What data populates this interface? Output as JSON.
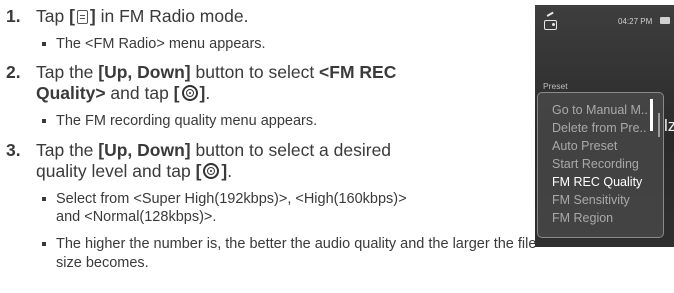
{
  "steps": [
    {
      "num": "1.",
      "pre": "Tap ",
      "b1": "[",
      "b2": "]",
      "post": " in FM Radio mode.",
      "symbol": "menu-icon"
    },
    {
      "num": "2.",
      "l1_pre": "Tap the ",
      "l1_bold": "[Up, Down]",
      "l1_mid": " button to select ",
      "l1_bold2": "<FM REC",
      "l2_bold": "Quality>",
      "l2_mid": " and tap ",
      "b1": "[",
      "b2": "]",
      "l2_end": ".",
      "symbol": "ok-icon"
    },
    {
      "num": "3.",
      "l1_pre": "Tap the ",
      "l1_bold": "[Up, Down]",
      "l1_mid": " button to select a desired",
      "l2_pre": "quality level and tap ",
      "b1": "[",
      "b2": "]",
      "l2_end": ".",
      "symbol": "ok-icon"
    }
  ],
  "bullets": {
    "b1": "The <FM Radio> menu appears.",
    "b2": "The FM recording quality menu appears.",
    "b3_l1": "Select from <Super High(192kbps)>, <High(160kbps)>",
    "b3_l2": "and <Normal(128kbps)>.",
    "b4_l1": "The higher the number is, the better the audio quality and the larger the file",
    "b4_l2": "size becomes."
  },
  "device": {
    "clock": "04:27 PM",
    "section_label": "Preset",
    "menu_items": [
      "Go to Manual M..",
      "Delete from Pre..",
      "Auto Preset",
      "Start Recording",
      "FM REC Quality",
      "FM Sensitivity",
      "FM Region"
    ],
    "selected_item": "FM REC Quality",
    "background_glyph": "lz"
  },
  "colors": {
    "text": "#3a3a3a",
    "device_bg": "#2f2f2f",
    "menu_selected": "#ffffff",
    "menu_normal": "#a9a9a9"
  }
}
